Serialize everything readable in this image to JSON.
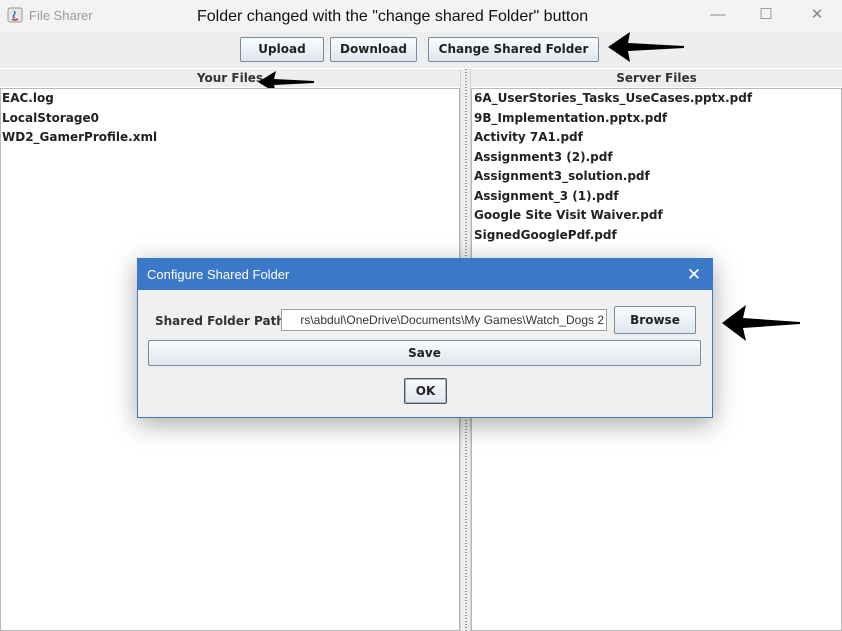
{
  "window": {
    "title": "File Sharer",
    "minimize": "—",
    "maximize": "☐",
    "close": "✕"
  },
  "annotation": {
    "caption": "Folder changed with the \"change shared Folder\" button"
  },
  "toolbar": {
    "upload_label": "Upload",
    "download_label": "Download",
    "change_folder_label": "Change Shared Folder"
  },
  "panels": {
    "your_files": {
      "header": "Your Files",
      "items": [
        "EAC.log",
        "LocalStorage0",
        "WD2_GamerProfile.xml"
      ]
    },
    "server_files": {
      "header": "Server Files",
      "items": [
        "6A_UserStories_Tasks_UseCases.pptx.pdf",
        "9B_Implementation.pptx.pdf",
        "Activity 7A1.pdf",
        "Assignment3 (2).pdf",
        "Assignment3_solution.pdf",
        "Assignment_3 (1).pdf",
        "Google Site Visit Waiver.pdf",
        "SignedGooglePdf.pdf"
      ]
    }
  },
  "dialog": {
    "title": "Configure Shared Folder",
    "close": "✕",
    "path_label": "Shared Folder Path:",
    "path_value": "rs\\abdul\\OneDrive\\Documents\\My Games\\Watch_Dogs 2",
    "browse_label": "Browse",
    "save_label": "Save",
    "ok_label": "OK"
  },
  "colors": {
    "dialog_title_bg": "#3c78c8",
    "annotation_arrow": "#000000"
  },
  "icons": [
    "java-app-icon",
    "arrow-left-icon"
  ]
}
